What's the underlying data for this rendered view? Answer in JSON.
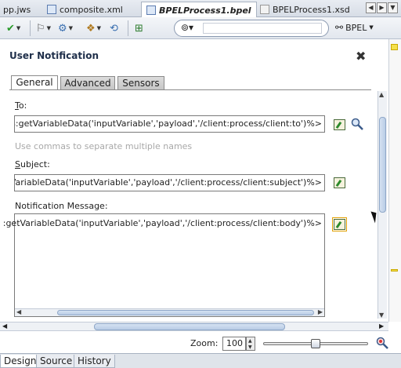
{
  "file_tabs": [
    {
      "label": "pp.jws"
    },
    {
      "label": "composite.xml"
    },
    {
      "label": "BPELProcess1.bpel"
    },
    {
      "label": "BPELProcess1.xsd"
    }
  ],
  "toolbar": {
    "search_placeholder": "",
    "bpel_label": "BPEL"
  },
  "dialog": {
    "title": "User Notification",
    "tabs": [
      {
        "label": "General"
      },
      {
        "label": "Advanced"
      },
      {
        "label": "Sensors"
      }
    ],
    "to": {
      "label_prefix": "T",
      "label_rest": "o:",
      "value": "ws:getVariableData('inputVariable','payload','/client:process/client:to')%>",
      "hint": "Use commas to separate multiple names"
    },
    "subject": {
      "label_prefix": "S",
      "label_rest": "ubject:",
      "value": "tVariableData('inputVariable','payload','/client:process/client:subject')%>"
    },
    "message": {
      "label": "Notification Message:",
      "value": ":getVariableData('inputVariable','payload','/client:process/client:body')%>"
    }
  },
  "zoom": {
    "label": "Zoom:",
    "value": "100",
    "slider_fraction": 0.5
  },
  "view_tabs": [
    {
      "label": "Design"
    },
    {
      "label": "Source"
    },
    {
      "label": "History"
    }
  ]
}
